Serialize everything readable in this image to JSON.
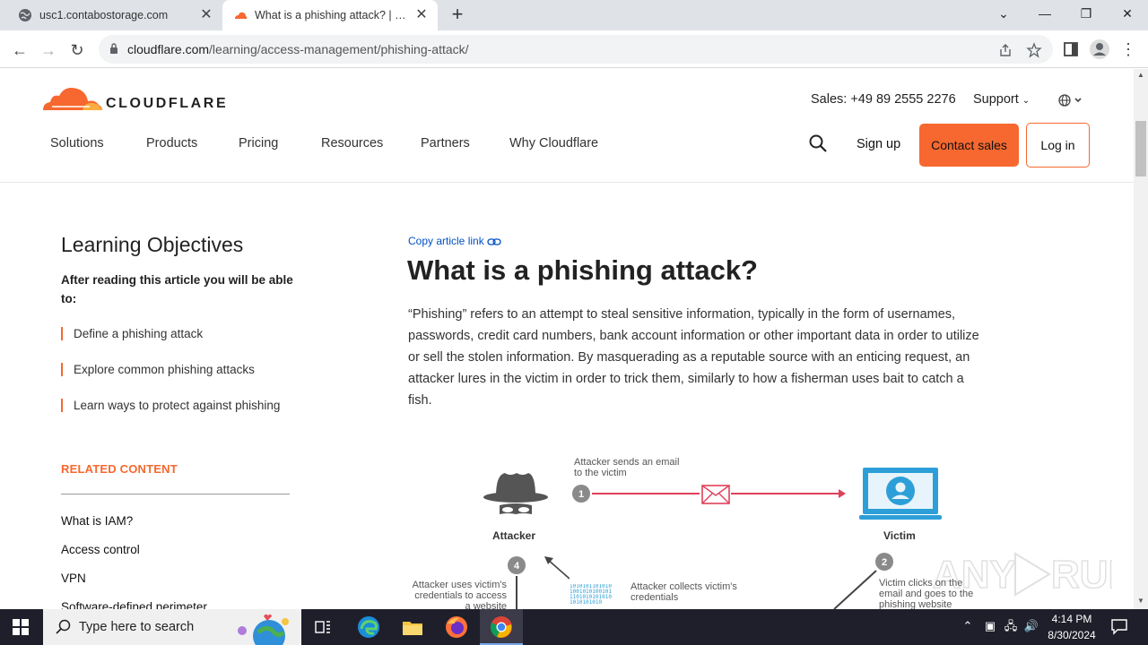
{
  "browser": {
    "tabs": [
      {
        "title": "usc1.contabostorage.com",
        "favicon": "globe-icon"
      },
      {
        "title": "What is a phishing attack? | Cloudflare",
        "favicon": "cloudflare-icon"
      }
    ],
    "url_host": "cloudflare.com",
    "url_path": "/learning/access-management/phishing-attack/"
  },
  "header": {
    "logo_text": "CLOUDFLARE",
    "sales": "Sales: +49 89 2555 2276",
    "support": "Support",
    "nav": [
      "Solutions",
      "Products",
      "Pricing",
      "Resources",
      "Partners",
      "Why Cloudflare"
    ],
    "sign_up": "Sign up",
    "contact_sales": "Contact sales",
    "log_in": "Log in"
  },
  "sidebar": {
    "title": "Learning Objectives",
    "intro": "After reading this article you will be able to:",
    "objectives": [
      "Define a phishing attack",
      "Explore common phishing attacks",
      "Learn ways to protect against phishing"
    ],
    "related_title": "RELATED CONTENT",
    "related": [
      "What is IAM?",
      "Access control",
      "VPN",
      "Software-defined perimeter"
    ]
  },
  "article": {
    "copy_link": "Copy article link",
    "title": "What is a phishing attack?",
    "body": "“Phishing” refers to an attempt to steal sensitive information, typically in the form of usernames, passwords, credit card numbers, bank account information or other important data in order to utilize or sell the stolen information. By masquerading as a reputable source with an enticing request, an attacker lures in the victim in order to trick them, similarly to how a fisherman uses bait to catch a fish."
  },
  "diagram": {
    "step1": "Attacker sends an email to the victim",
    "attacker": "Attacker",
    "victim": "Victim",
    "num1": "1",
    "num2": "2",
    "num4": "4",
    "step4": "Attacker uses victim's credentials to access a website",
    "collect": "Attacker collects victim's credentials",
    "step2": "Victim clicks on the email and goes to the phishing website",
    "binary": "1010101101010\n1001010100101\n1101010101010\n1010101010"
  },
  "taskbar": {
    "search_placeholder": "Type here to search",
    "time": "4:14 PM",
    "date": "8/30/2024"
  },
  "colors": {
    "cloudflare_orange": "#f6682f",
    "link_blue": "#0051c3",
    "diagram_red": "#e0405a",
    "diagram_blue": "#2d9fd8"
  }
}
